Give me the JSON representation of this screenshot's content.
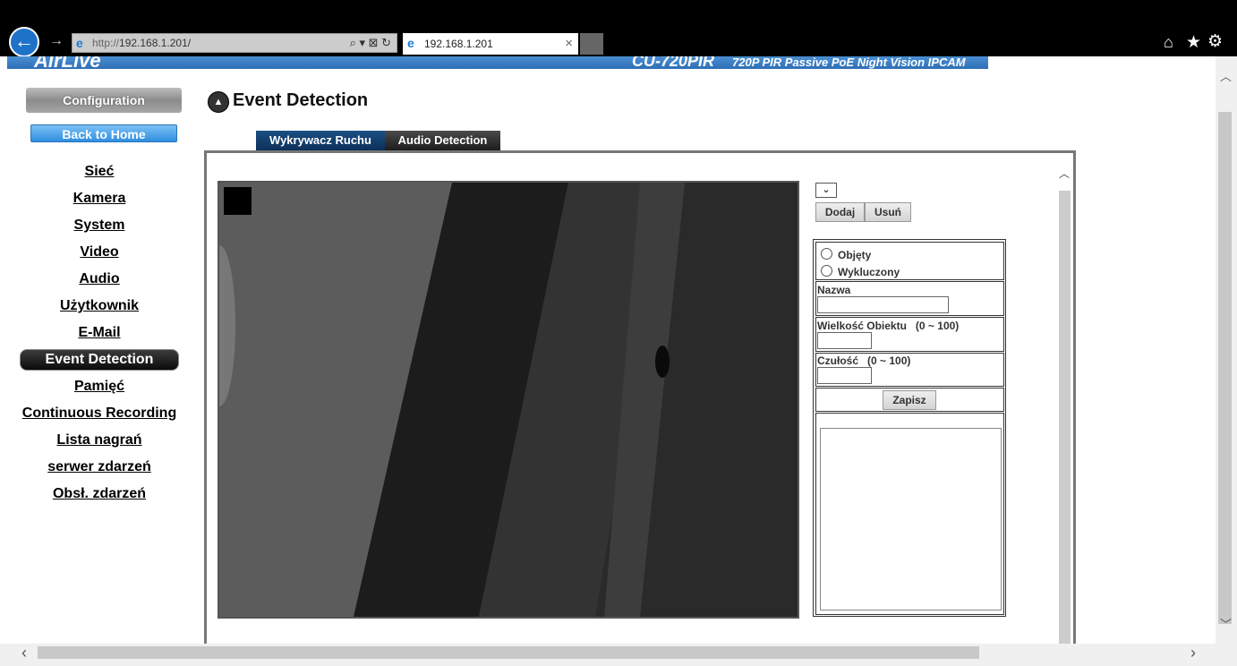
{
  "browser": {
    "url_protocol": "http://",
    "url_host": "192.168.1.201/",
    "tab_title": "192.168.1.201",
    "address_tools": "⌕ ▾ ⊠ ↻",
    "tab_close": "×"
  },
  "banner": {
    "logo": "AirLive",
    "model": "CU-720PIR",
    "description": "720P PIR Passive PoE Night Vision IPCAM"
  },
  "sidebar": {
    "config_label": "Configuration",
    "home_label": "Back to Home",
    "items": [
      {
        "label": "Sieć"
      },
      {
        "label": "Kamera"
      },
      {
        "label": "System"
      },
      {
        "label": "Video"
      },
      {
        "label": "Audio"
      },
      {
        "label": "Użytkownik"
      },
      {
        "label": "E-Mail"
      },
      {
        "label": "Event Detection",
        "active": true
      },
      {
        "label": "Pamięć"
      },
      {
        "label": "Continuous Recording"
      },
      {
        "label": "Lista nagrań"
      },
      {
        "label": "serwer zdarzeń"
      },
      {
        "label": "Obsł. zdarzeń"
      }
    ]
  },
  "main": {
    "title": "Event Detection",
    "tabs": [
      {
        "label": "Wykrywacz Ruchu",
        "active": true
      },
      {
        "label": "Audio Detection",
        "active": false
      }
    ]
  },
  "controls": {
    "dropdown_value": "",
    "add_label": "Dodaj",
    "delete_label": "Usuń",
    "radio_included": "Objęty",
    "radio_excluded": "Wykluczony",
    "name_label": "Nazwa",
    "name_value": "",
    "object_size_label": "Wielkość Obiektu   (0 ~ 100)",
    "object_size_value": "",
    "sensitivity_label": "Czułość   (0 ~ 100)",
    "sensitivity_value": "",
    "save_label": "Zapisz"
  },
  "icons": {
    "back": "←",
    "forward": "→",
    "home": "⌂",
    "star": "★",
    "gear": "⚙"
  }
}
